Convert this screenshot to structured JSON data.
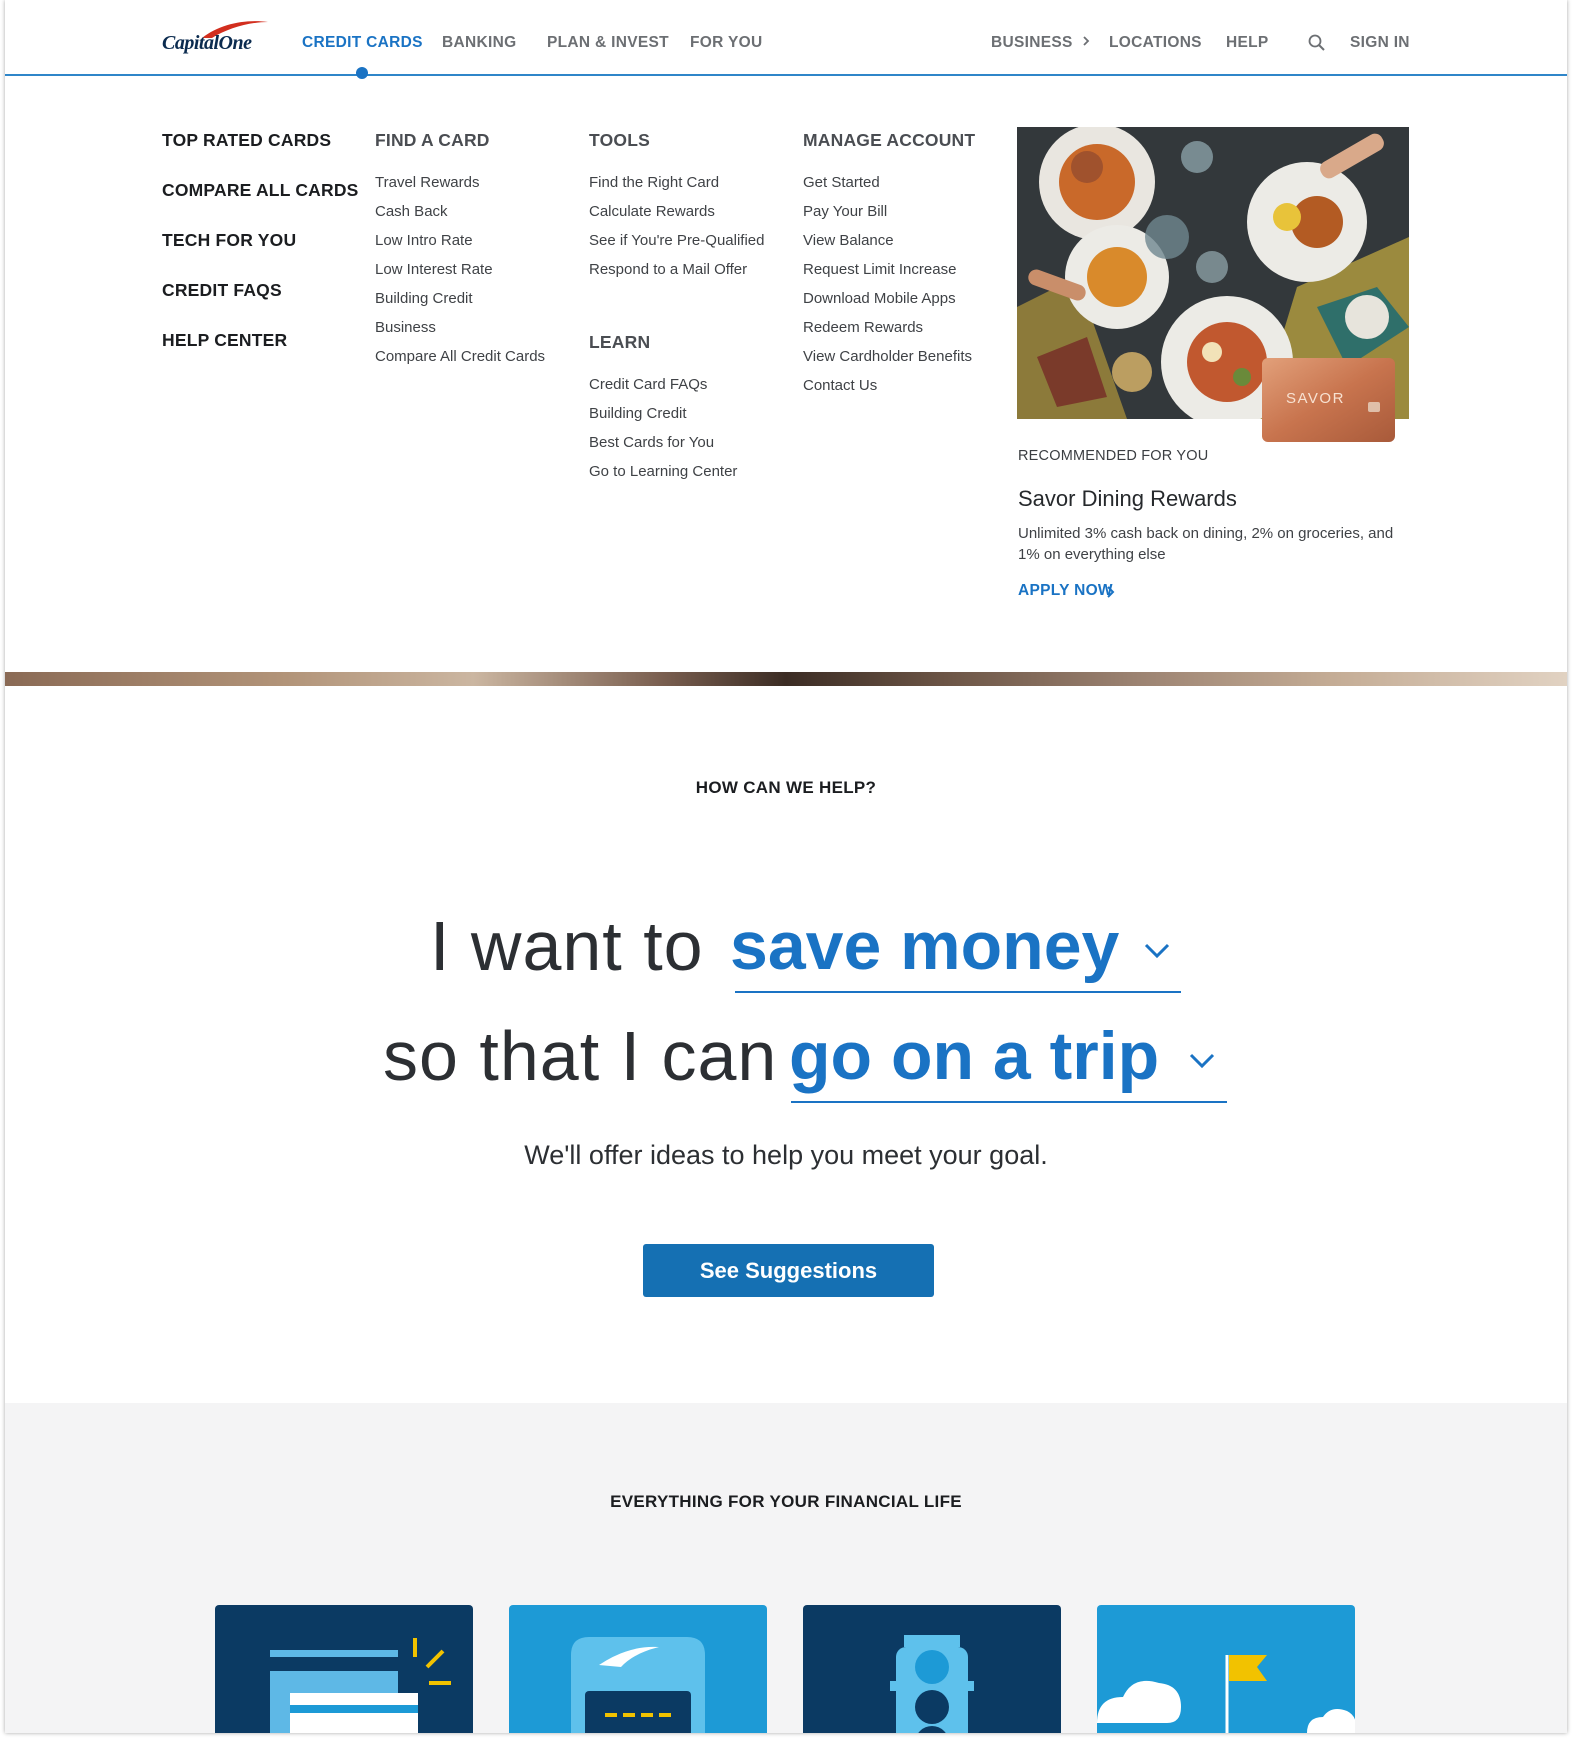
{
  "brand": {
    "logo_text": "CapitalOne",
    "accent_color": "#1a73c4",
    "dark_navy": "#0b2b4f",
    "cta_color": "#1570b3"
  },
  "nav": {
    "primary": [
      "CREDIT CARDS",
      "BANKING",
      "PLAN & INVEST",
      "FOR YOU"
    ],
    "active": "CREDIT CARDS",
    "business": "BUSINESS",
    "locations": "LOCATIONS",
    "help": "HELP",
    "search_icon": "search-icon",
    "sign_in": "SIGN IN"
  },
  "mega_menu": {
    "quick_links": [
      "TOP RATED CARDS",
      "COMPARE ALL CARDS",
      "TECH FOR YOU",
      "CREDIT FAQS",
      "HELP CENTER"
    ],
    "find_a_card": {
      "heading": "FIND A CARD",
      "links": [
        "Travel Rewards",
        "Cash Back",
        "Low Intro Rate",
        "Low Interest Rate",
        "Building Credit",
        "Business",
        "Compare All Credit Cards"
      ]
    },
    "tools": {
      "heading": "TOOLS",
      "links": [
        "Find the Right Card",
        "Calculate Rewards",
        "See if You're Pre-Qualified",
        "Respond to a Mail Offer"
      ]
    },
    "learn": {
      "heading": "LEARN",
      "links": [
        "Credit Card FAQs",
        "Building Credit",
        "Best Cards for You",
        "Go to Learning Center"
      ]
    },
    "manage_account": {
      "heading": "MANAGE ACCOUNT",
      "links": [
        "Get Started",
        "Pay Your Bill",
        "View Balance",
        "Request Limit Increase",
        "Download Mobile Apps",
        "Redeem Rewards",
        "View Cardholder Benefits",
        "Contact Us"
      ]
    },
    "promo": {
      "card_brand": "SAVOR",
      "label": "RECOMMENDED FOR YOU",
      "title": "Savor Dining Rewards",
      "description": "Unlimited 3% cash back on dining, 2% on groceries, and 1% on everything else",
      "apply": "APPLY NOW"
    }
  },
  "help_section": {
    "heading": "HOW CAN WE HELP?",
    "phrase1": "I want to",
    "choice1": "save money",
    "phrase2": "so that I can",
    "choice2": "go on a trip",
    "subtext": "We'll offer ideas to help you meet your goal.",
    "cta": "See Suggestions"
  },
  "everything_section": {
    "heading": "EVERYTHING FOR YOUR FINANCIAL LIFE",
    "tiles": [
      {
        "icon": "credit-card-icon",
        "bg": "#0b3a63"
      },
      {
        "icon": "bank-icon",
        "bg": "#1d9ad6"
      },
      {
        "icon": "traffic-light-icon",
        "bg": "#0b3a63"
      },
      {
        "icon": "goal-flag-icon",
        "bg": "#1d9ad6"
      }
    ]
  }
}
